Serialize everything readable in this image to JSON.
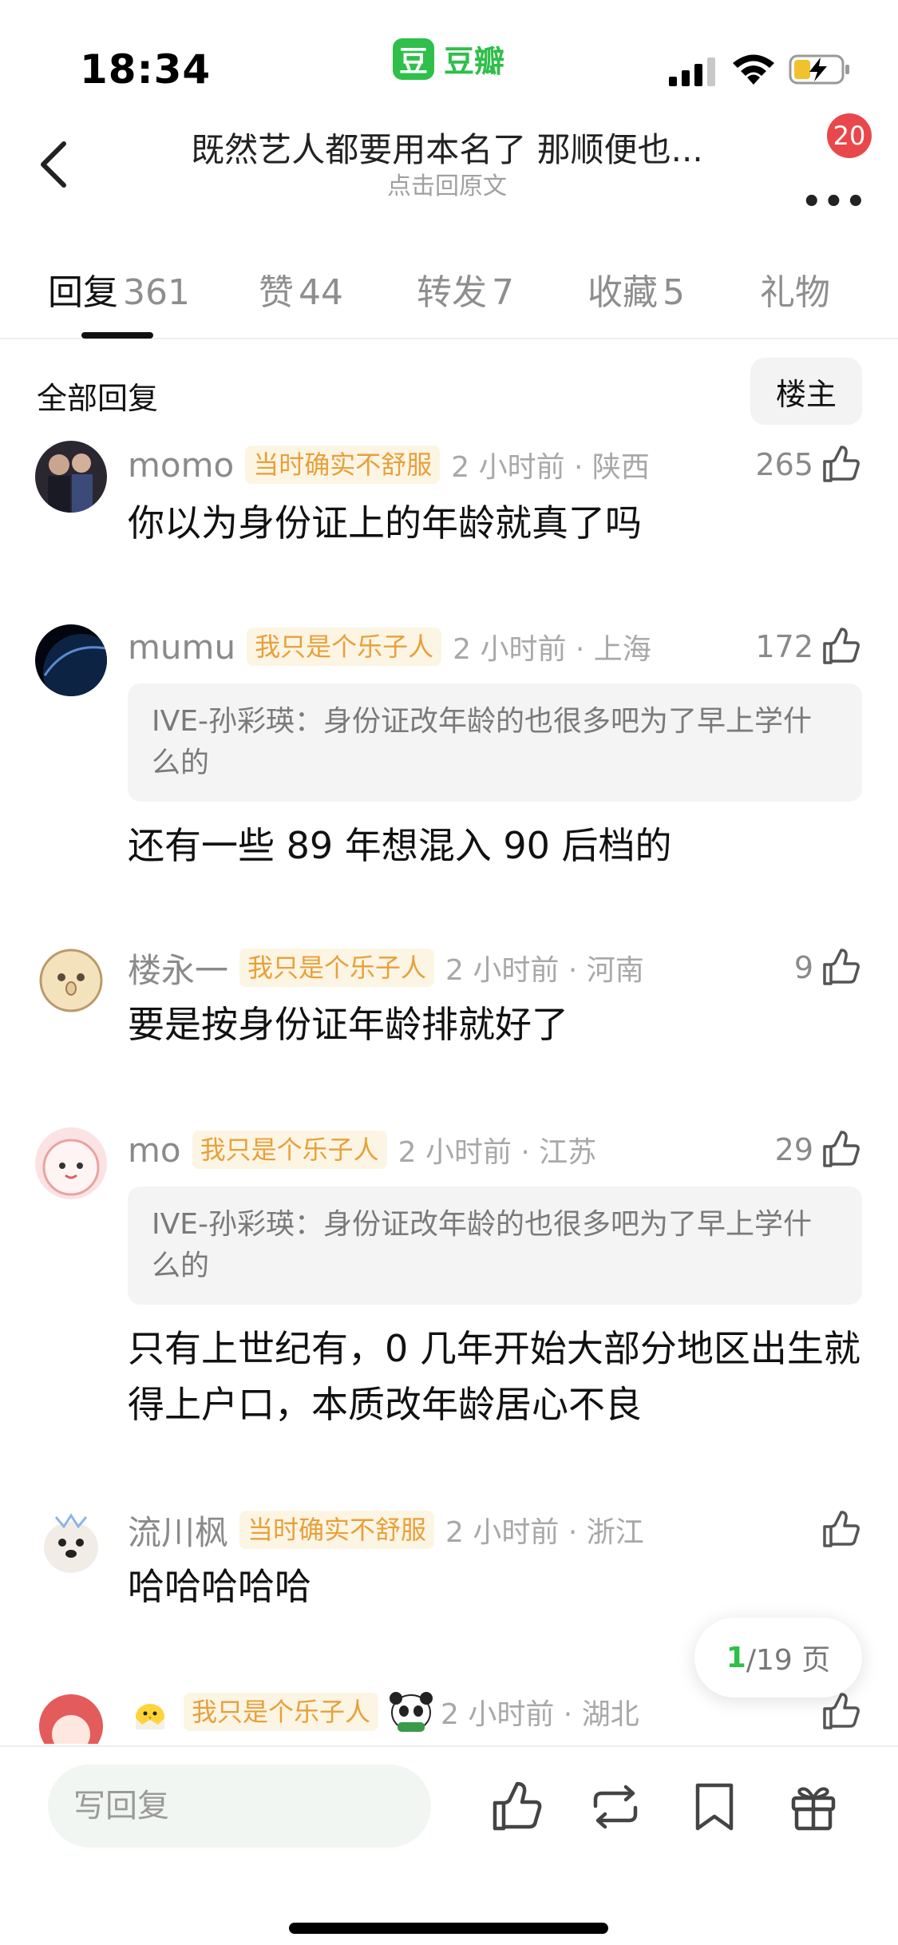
{
  "status_bar": {
    "time": "18:34",
    "app_logo_char": "豆",
    "app_name": "豆瓣"
  },
  "header": {
    "title": "既然艺人都要用本名了  那顺便也...",
    "subtitle": "点击回原文",
    "notification_count": "20"
  },
  "tabs": [
    {
      "label": "回复",
      "count": "361",
      "active": true
    },
    {
      "label": "赞",
      "count": "44"
    },
    {
      "label": "转发",
      "count": "7"
    },
    {
      "label": "收藏",
      "count": "5"
    },
    {
      "label": "礼物",
      "count": ""
    }
  ],
  "section": {
    "title": "全部回复",
    "filter_button": "楼主"
  },
  "comments": [
    {
      "username": "momo",
      "tag": "当时确实不舒服",
      "time_location": "2 小时前 · 陕西",
      "likes": "265",
      "text": "你以为身份证上的年龄就真了吗"
    },
    {
      "username": "mumu",
      "tag": "我只是个乐子人",
      "time_location": "2 小时前 · 上海",
      "likes": "172",
      "quote": "IVE-孙彩瑛：身份证改年龄的也很多吧为了早上学什么的",
      "text": "还有一些 89 年想混入 90 后档的"
    },
    {
      "username": "楼永一",
      "tag": "我只是个乐子人",
      "time_location": "2 小时前 · 河南",
      "likes": "9",
      "text": "要是按身份证年龄排就好了"
    },
    {
      "username": "mo",
      "tag": "我只是个乐子人",
      "time_location": "2 小时前 · 江苏",
      "likes": "29",
      "quote": "IVE-孙彩瑛：身份证改年龄的也很多吧为了早上学什么的",
      "text": "只有上世纪有，0 几年开始大部分地区出生就得上户口，本质改年龄居心不良"
    },
    {
      "username": "流川枫",
      "tag": "当时确实不舒服",
      "time_location": "2 小时前 · 浙江",
      "likes": "",
      "text": "哈哈哈哈哈"
    },
    {
      "username": "",
      "tag": "我只是个乐子人",
      "time_location": "2 小时前 · 湖北",
      "likes": ""
    }
  ],
  "pagination": {
    "current": "1",
    "total_text": "/19 页"
  },
  "bottom_bar": {
    "reply_placeholder": "写回复"
  },
  "colors": {
    "brand_green": "#2fbf4a",
    "tag_text": "#e8a03a",
    "tag_bg": "#fdf5e4",
    "badge_red": "#e8484b"
  },
  "icons": [
    "back-icon",
    "more-icon",
    "thumbs-up-icon",
    "repost-icon",
    "bookmark-icon",
    "gift-icon"
  ]
}
